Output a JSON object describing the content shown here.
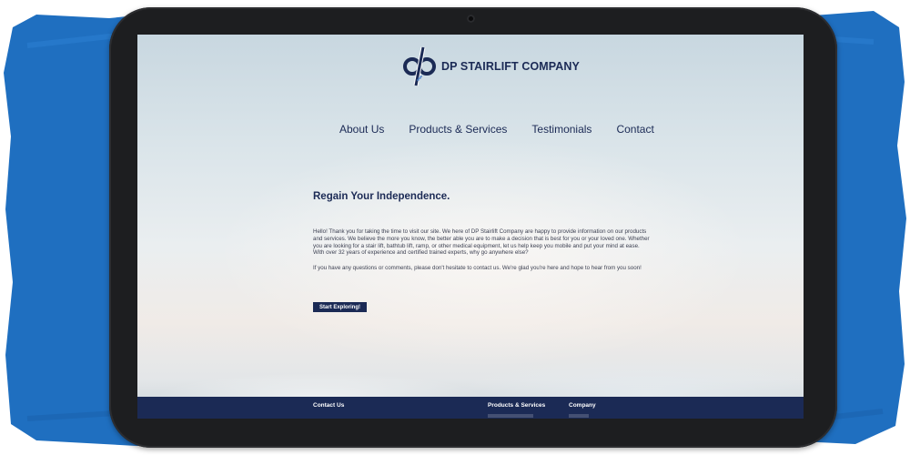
{
  "colors": {
    "brush_blue": "#1f6fc0",
    "brand_navy": "#1b2a55",
    "bezel": "#1d1e20"
  },
  "header": {
    "logo_icon": "dp-monogram-icon",
    "company_name": "DP STAIRLIFT COMPANY"
  },
  "nav": {
    "items": [
      "About Us",
      "Products & Services",
      "Testimonials",
      "Contact"
    ]
  },
  "main": {
    "headline": "Regain Your Independence.",
    "paragraph1": "Hello! Thank you for taking the time to visit our site. We here of DP Stairlift Company are happy to provide information on our products and services. We believe the more you know, the better able you are to make a decision that is best for you or your loved one. Whether you are looking for a stair lift, bathtub lift, ramp, or other medical equipment, let us help keep you mobile and put your mind at ease. With over 32 years of experience and certified trained experts, why go anywhere else?",
    "paragraph2": "If you have any questions or comments, please don't hesitate to contact us. We're glad you're here and hope to hear from you soon!",
    "cta_label": "Start Exploring!"
  },
  "footer": {
    "col1": "Contact Us",
    "col2": "Products & Services",
    "col3": "Company"
  }
}
